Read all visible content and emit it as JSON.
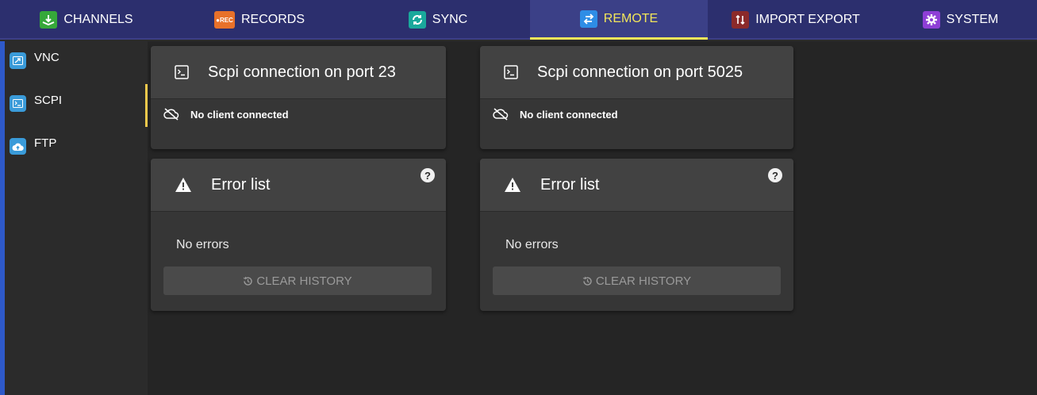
{
  "nav": {
    "tabs": [
      {
        "label": "CHANNELS",
        "icon": "channels-icon",
        "color": "#36a83a"
      },
      {
        "label": "RECORDS",
        "icon": "rec-icon",
        "icon_text": "●REC",
        "color": "#e8712a"
      },
      {
        "label": "SYNC",
        "icon": "sync-icon",
        "color": "#1aa89c"
      },
      {
        "label": "REMOTE",
        "icon": "remote-icon",
        "color": "#2e8de6",
        "active": true
      },
      {
        "label": "IMPORT EXPORT",
        "icon": "import-export-icon",
        "color": "#8b2a2a"
      },
      {
        "label": "SYSTEM",
        "icon": "gear-icon",
        "color": "#8e3fd6"
      }
    ],
    "active_color": "#f2e65a"
  },
  "sidebar": {
    "items": [
      {
        "label": "VNC",
        "icon": "vnc-icon"
      },
      {
        "label": "SCPI",
        "icon": "terminal-icon",
        "active": true
      },
      {
        "label": "FTP",
        "icon": "cloud-upload-icon"
      }
    ]
  },
  "connections": [
    {
      "title": "Scpi connection on port 23",
      "status": "No client connected"
    },
    {
      "title": "Scpi connection on port 5025",
      "status": "No client connected"
    }
  ],
  "error_lists": [
    {
      "title": "Error list",
      "message": "No errors",
      "button": "CLEAR HISTORY",
      "help": "?"
    },
    {
      "title": "Error list",
      "message": "No errors",
      "button": "CLEAR HISTORY",
      "help": "?"
    }
  ]
}
